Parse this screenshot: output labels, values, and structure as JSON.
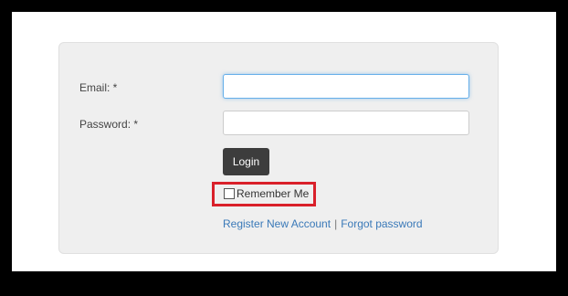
{
  "form": {
    "email_label": "Email: *",
    "email_value": "",
    "password_label": "Password: *",
    "password_value": "",
    "login_label": "Login",
    "remember_label": "Remember Me",
    "remember_checked": false,
    "register_link": "Register New Account",
    "separator": "|",
    "forgot_link": "Forgot password"
  },
  "colors": {
    "highlight": "#d9202a",
    "link": "#3a79b8",
    "button": "#3d3d3d",
    "panel": "#efefef",
    "focus": "#66afe9"
  }
}
